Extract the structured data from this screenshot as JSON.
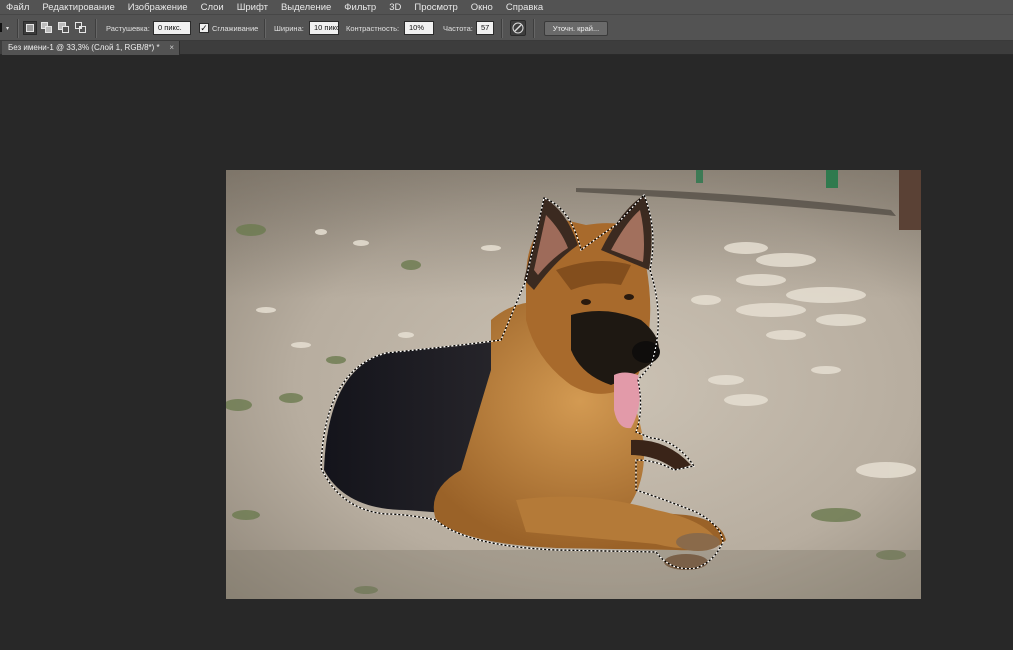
{
  "menu": [
    "Файл",
    "Редактирование",
    "Изображение",
    "Слои",
    "Шрифт",
    "Выделение",
    "Фильтр",
    "3D",
    "Просмотр",
    "Окно",
    "Справка"
  ],
  "options": {
    "feather_label": "Растушевка:",
    "feather_value": "0 пикс.",
    "antialias_checked": true,
    "antialias_label": "Сглаживание",
    "width_label": "Ширина:",
    "width_value": "10 пикс",
    "contrast_label": "Контрастность:",
    "contrast_value": "10%",
    "frequency_label": "Частота:",
    "frequency_value": "57",
    "refine_edge_label": "Уточн. край..."
  },
  "document": {
    "tab_title": "Без имени-1 @ 33,3% (Слой 1, RGB/8*) *",
    "close_glyph": "×"
  },
  "colors": {
    "ui_panel": "#535353",
    "workspace": "#282828",
    "field_bg": "#f1f1f1"
  },
  "icons": {
    "new_selection": "new-selection-icon",
    "add_selection": "add-to-selection-icon",
    "subtract_selection": "subtract-from-selection-icon",
    "intersect_selection": "intersect-selection-icon",
    "pen_pressure": "pen-pressure-icon"
  }
}
